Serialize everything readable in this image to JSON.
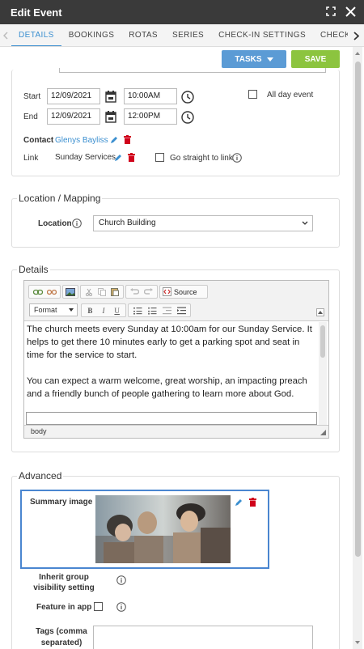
{
  "window": {
    "title": "Edit Event"
  },
  "tabs": [
    {
      "label": "DETAILS",
      "active": true
    },
    {
      "label": "BOOKINGS"
    },
    {
      "label": "ROTAS"
    },
    {
      "label": "SERIES"
    },
    {
      "label": "CHECK-IN SETTINGS"
    },
    {
      "label": "CHECK-IN"
    }
  ],
  "actions": {
    "tasks_label": "TASKS",
    "save_label": "SAVE"
  },
  "colors": {
    "accent": "#3b8fd0",
    "tasks": "#5b9bd5",
    "save": "#8cc43f",
    "delete": "#d0021b",
    "titlebar": "#3a3a3a"
  },
  "schedule": {
    "start_label": "Start",
    "start_date": "12/09/2021",
    "start_time": "10:00AM",
    "end_label": "End",
    "end_date": "12/09/2021",
    "end_time": "12:00PM",
    "all_day_label": "All day event",
    "contact_label": "Contact",
    "contact_value": "Glenys Bayliss",
    "link_label": "Link",
    "link_value": "Sunday Services",
    "go_straight_label": "Go straight to link"
  },
  "location": {
    "legend": "Location / Mapping",
    "label": "Location",
    "value": "Church Building"
  },
  "details": {
    "legend": "Details",
    "format_label": "Format",
    "source_label": "Source",
    "paragraph1": "The church meets every Sunday at 10:00am for our Sunday Service. It helps to get there 10 minutes early to get a parking spot and seat in time for the service to start.",
    "paragraph2": "You can expect a warm welcome, great worship, an impacting preach and a friendly bunch of people gathering to learn more about God.",
    "status_path": "body"
  },
  "advanced": {
    "legend": "Advanced",
    "summary_image_label": "Summary image",
    "inherit_label_1": "Inherit group",
    "inherit_label_2": "visibility setting",
    "feature_label": "Feature in app",
    "tags_label_1": "Tags (comma",
    "tags_label_2": "separated)"
  }
}
